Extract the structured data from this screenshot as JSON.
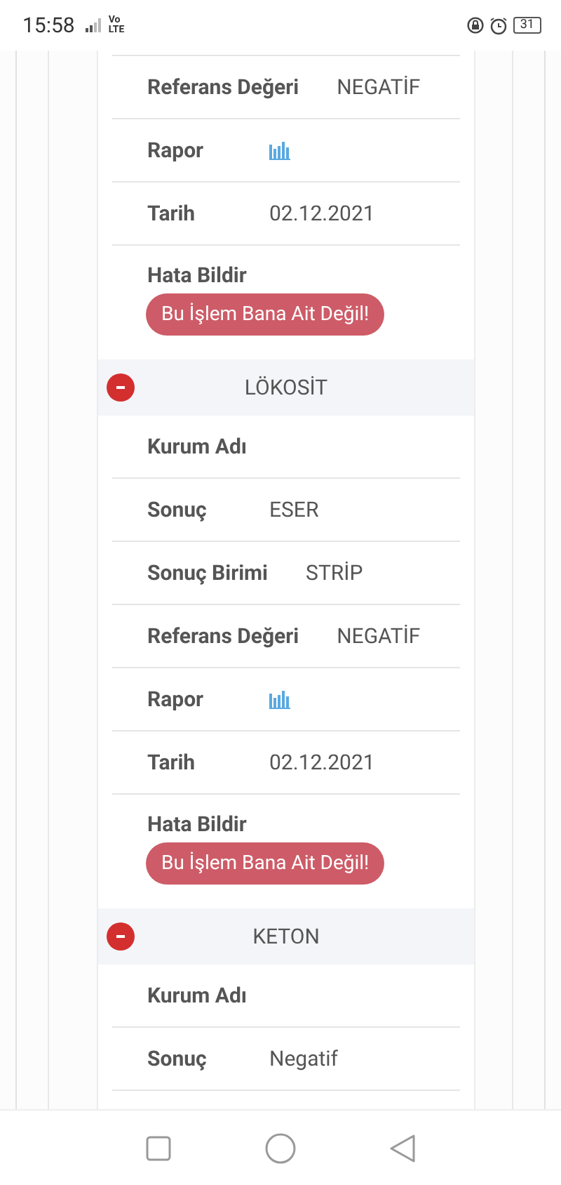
{
  "status_bar": {
    "time": "15:58",
    "network": [
      "Vo",
      "LTE"
    ],
    "battery": "31"
  },
  "sections": [
    {
      "rows": [
        {
          "kind": "text",
          "label": "Referans Değeri",
          "value": "NEGATİF"
        },
        {
          "kind": "chart",
          "label": "Rapor"
        },
        {
          "kind": "text",
          "label": "Tarih",
          "value": "02.12.2021"
        },
        {
          "kind": "button",
          "label": "Hata Bildir",
          "button": "Bu İşlem Bana Ait Değil!"
        }
      ]
    },
    {
      "title": "LÖKOSİT",
      "expanded": true,
      "rows": [
        {
          "kind": "text",
          "label": "Kurum Adı"
        },
        {
          "kind": "text",
          "label": "Sonuç",
          "value": "ESER"
        },
        {
          "kind": "text",
          "label": "Sonuç Birimi",
          "value": "STRİP"
        },
        {
          "kind": "text",
          "label": "Referans Değeri",
          "value": "NEGATİF"
        },
        {
          "kind": "chart",
          "label": "Rapor"
        },
        {
          "kind": "text",
          "label": "Tarih",
          "value": "02.12.2021"
        },
        {
          "kind": "button",
          "label": "Hata Bildir",
          "button": "Bu İşlem Bana Ait Değil!"
        }
      ]
    },
    {
      "title": "KETON",
      "expanded": true,
      "rows": [
        {
          "kind": "text",
          "label": "Kurum Adı"
        },
        {
          "kind": "text",
          "label": "Sonuç",
          "value": "Negatif"
        }
      ]
    }
  ]
}
